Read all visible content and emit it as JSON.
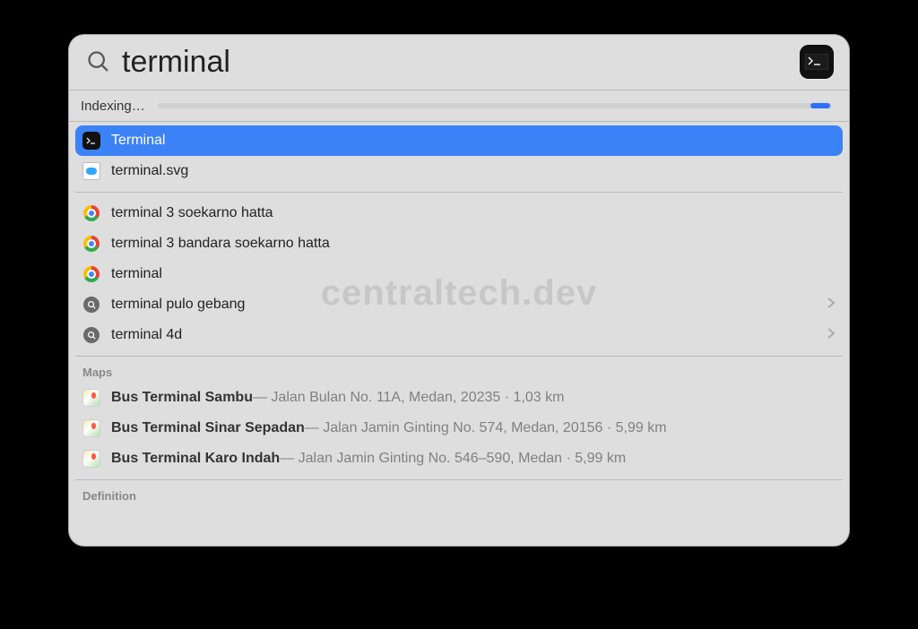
{
  "search": {
    "query": "terminal"
  },
  "indexing_label": "Indexing…",
  "watermark_text": "centraltech.dev",
  "top_hits": [
    {
      "icon": "terminal-app",
      "label": "Terminal",
      "selected": true
    },
    {
      "icon": "cloud-doc",
      "label": "terminal.svg",
      "selected": false
    }
  ],
  "web_suggestions": [
    {
      "icon": "chrome",
      "label": "terminal 3 soekarno hatta",
      "chevron": false
    },
    {
      "icon": "chrome",
      "label": "terminal 3 bandara soekarno hatta",
      "chevron": false
    },
    {
      "icon": "chrome",
      "label": "terminal",
      "chevron": false
    },
    {
      "icon": "search",
      "label": "terminal pulo gebang",
      "chevron": true
    },
    {
      "icon": "search",
      "label": "terminal 4d",
      "chevron": true
    }
  ],
  "sections": {
    "maps_header": "Maps",
    "definition_header": "Definition"
  },
  "maps_results": [
    {
      "title": "Bus Terminal Sambu",
      "detail": " — Jalan Bulan No. 11A, Medan,  20235 · 1,03 km"
    },
    {
      "title": "Bus Terminal Sinar Sepadan",
      "detail": " — Jalan Jamin Ginting No. 574, Medan,  20156 · 5,99 km"
    },
    {
      "title": "Bus Terminal Karo Indah",
      "detail": " — Jalan Jamin Ginting No. 546–590, Medan · 5,99 km"
    }
  ]
}
